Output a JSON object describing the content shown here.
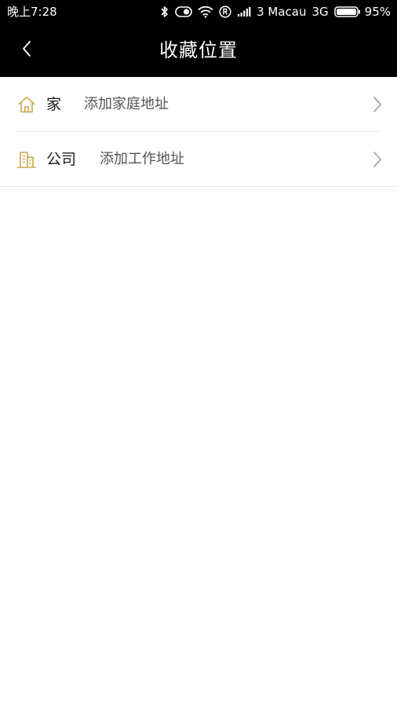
{
  "status_bar": {
    "time": "晚上7:28",
    "carrier": "3 Macau",
    "network": "3G",
    "battery": "95%",
    "icons": [
      "bluetooth-icon",
      "toggle-icon",
      "wifi-icon",
      "registered-icon",
      "signal-icon",
      "battery-icon"
    ]
  },
  "header": {
    "title": "收藏位置",
    "back_icon": "chevron-left-icon"
  },
  "colors": {
    "bar_bg": "#000000",
    "accent_gold": "#C9A74A",
    "text_primary": "#1a1a1a",
    "text_secondary": "#555555",
    "divider": "#e6e6e6"
  },
  "locations": [
    {
      "label": "家",
      "value": "添加家庭地址",
      "icon": "home-icon"
    },
    {
      "label": "公司",
      "value": "添加工作地址",
      "icon": "office-building-icon"
    }
  ]
}
